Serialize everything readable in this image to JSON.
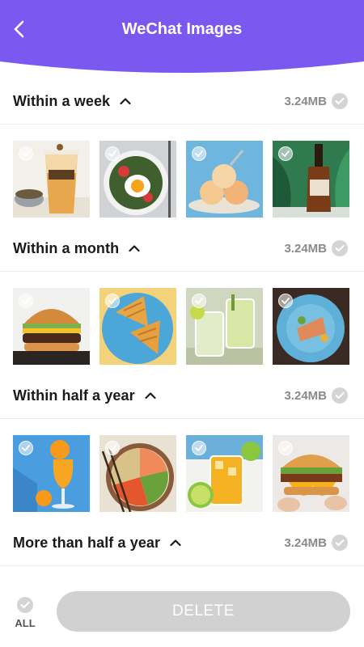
{
  "header": {
    "title": "WeChat Images",
    "accent": "#7b59f0"
  },
  "sections": [
    {
      "title": "Within a week",
      "size": "3.24MB",
      "images": [
        {
          "subject": "iced sauce drink cup with spoon"
        },
        {
          "subject": "fried egg salad plate"
        },
        {
          "subject": "ice cream scoops on plate"
        },
        {
          "subject": "bottle of liquor with leaves"
        }
      ]
    },
    {
      "title": "Within a month",
      "size": "3.24MB",
      "images": [
        {
          "subject": "burger on wood board"
        },
        {
          "subject": "waffles on blue plate"
        },
        {
          "subject": "cucumber lime drinks"
        },
        {
          "subject": "salmon dish on blue plate"
        }
      ]
    },
    {
      "title": "Within half a year",
      "size": "3.24MB",
      "images": [
        {
          "subject": "orange juice glass"
        },
        {
          "subject": "poke bowl with chopsticks"
        },
        {
          "subject": "iced orange drink with lime"
        },
        {
          "subject": "egg burger held in hand"
        }
      ]
    },
    {
      "title": "More than half a year",
      "size": "3.24MB",
      "images": []
    }
  ],
  "footer": {
    "all_label": "ALL",
    "delete_label": "DELETE"
  },
  "colors": {
    "check_grey": "#d4d4d4",
    "delete_disabled": "#d1d1d1"
  }
}
